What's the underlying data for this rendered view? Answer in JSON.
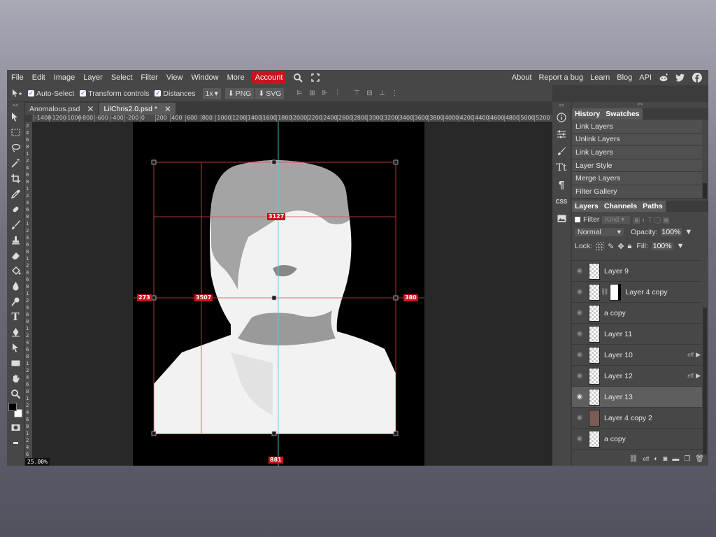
{
  "menubar": {
    "items": [
      "File",
      "Edit",
      "Image",
      "Layer",
      "Select",
      "Filter",
      "View",
      "Window",
      "More"
    ],
    "account": "Account",
    "right": [
      "About",
      "Report a bug",
      "Learn",
      "Blog",
      "API"
    ]
  },
  "options": {
    "auto_select": "Auto-Select",
    "transform": "Transform controls",
    "distances": "Distances",
    "scale": "1x",
    "png": "PNG",
    "svg": "SVG"
  },
  "tabs": [
    {
      "label": "Anomalous.psd"
    },
    {
      "label": "LilChris2.0.psd *"
    }
  ],
  "ruler_labels": [
    "-1400",
    "-1200",
    "-1000",
    "-800",
    "-600",
    "-400",
    "-200",
    "0",
    "200",
    "400",
    "600",
    "800",
    "1000",
    "1200",
    "1400",
    "1600",
    "1800",
    "2000",
    "2200",
    "2400",
    "2600",
    "2800",
    "3000",
    "3200",
    "3400",
    "3600",
    "3800",
    "4000",
    "4200",
    "4400",
    "4600",
    "4800",
    "5000",
    "5200"
  ],
  "vruler_labels": [
    "2",
    "4",
    "6",
    "8",
    "1",
    "2",
    "4",
    "6",
    "8",
    "1",
    "2",
    "4",
    "6",
    "8",
    "1",
    "2",
    "4",
    "6",
    "8",
    "1",
    "2",
    "4",
    "6",
    "8",
    "1",
    "2",
    "4",
    "6",
    "8",
    "1",
    "2",
    "4",
    "6",
    "8",
    "1",
    "2",
    "4",
    "6",
    "8",
    "1",
    "2",
    "4",
    "6",
    "8",
    "1",
    "2",
    "4",
    "6",
    "8"
  ],
  "zoom": "25.00%",
  "measures": {
    "top": "3127",
    "left": "273",
    "inner": "3507",
    "right": "380",
    "bottom": "881"
  },
  "history": {
    "tab1": "History",
    "tab2": "Swatches",
    "items": [
      "Link Layers",
      "Unlink Layers",
      "Link Layers",
      "Layer Style",
      "Merge Layers",
      "Filter Gallery"
    ]
  },
  "layers_panel": {
    "tab1": "Layers",
    "tab2": "Channels",
    "tab3": "Paths",
    "filter": "Filter",
    "kind": "Kind",
    "blend": "Normal",
    "opacity_label": "Opacity:",
    "opacity": "100%",
    "lock_label": "Lock:",
    "fill_label": "Fill:",
    "fill": "100%",
    "layers": [
      {
        "name": "Layer 9"
      },
      {
        "name": "Layer 4 copy"
      },
      {
        "name": "a copy"
      },
      {
        "name": "Layer 11"
      },
      {
        "name": "Layer 10",
        "eff": "eff"
      },
      {
        "name": "Layer 12",
        "eff": "eff"
      },
      {
        "name": "Layer 13"
      },
      {
        "name": "Layer 4 copy 2"
      },
      {
        "name": "a copy"
      }
    ]
  },
  "sidestrip": {
    "css": "CSS"
  },
  "colors": {
    "accent": "#c9131e",
    "guide": "#59c8f0"
  }
}
